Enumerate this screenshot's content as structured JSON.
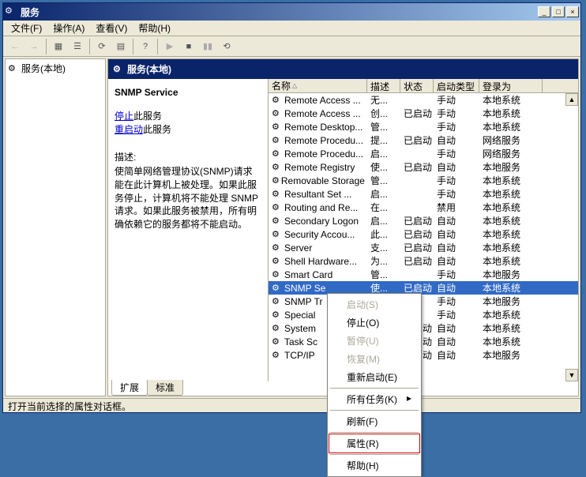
{
  "window": {
    "title": "服务",
    "minimize": "_",
    "maximize": "□",
    "close": "×"
  },
  "menubar": {
    "file": "文件(F)",
    "action": "操作(A)",
    "view": "查看(V)",
    "help": "帮助(H)"
  },
  "tree": {
    "root": "服务(本地)"
  },
  "main_header": "服务(本地)",
  "detail": {
    "service_name": "SNMP Service",
    "stop_link": "停止",
    "stop_suffix": "此服务",
    "restart_link": "重启动",
    "restart_suffix": "此服务",
    "desc_label": "描述:",
    "desc_text": "使简单网络管理协议(SNMP)请求能在此计算机上被处理。如果此服务停止，计算机将不能处理 SNMP 请求。如果此服务被禁用，所有明确依赖它的服务都将不能启动。"
  },
  "columns": {
    "name": "名称",
    "desc": "描述",
    "status": "状态",
    "start": "启动类型",
    "logon": "登录为"
  },
  "services": [
    {
      "name": "Remote Access ...",
      "desc": "无...",
      "status": "",
      "start": "手动",
      "logon": "本地系统"
    },
    {
      "name": "Remote Access ...",
      "desc": "创...",
      "status": "已启动",
      "start": "手动",
      "logon": "本地系统"
    },
    {
      "name": "Remote Desktop...",
      "desc": "管...",
      "status": "",
      "start": "手动",
      "logon": "本地系统"
    },
    {
      "name": "Remote Procedu...",
      "desc": "提...",
      "status": "已启动",
      "start": "自动",
      "logon": "网络服务"
    },
    {
      "name": "Remote Procedu...",
      "desc": "启...",
      "status": "",
      "start": "手动",
      "logon": "网络服务"
    },
    {
      "name": "Remote Registry",
      "desc": "使...",
      "status": "已启动",
      "start": "自动",
      "logon": "本地服务"
    },
    {
      "name": "Removable Storage",
      "desc": "管...",
      "status": "",
      "start": "手动",
      "logon": "本地系统"
    },
    {
      "name": "Resultant Set ...",
      "desc": "启...",
      "status": "",
      "start": "手动",
      "logon": "本地系统"
    },
    {
      "name": "Routing and Re...",
      "desc": "在...",
      "status": "",
      "start": "禁用",
      "logon": "本地系统"
    },
    {
      "name": "Secondary Logon",
      "desc": "启...",
      "status": "已启动",
      "start": "自动",
      "logon": "本地系统"
    },
    {
      "name": "Security Accou...",
      "desc": "此...",
      "status": "已启动",
      "start": "自动",
      "logon": "本地系统"
    },
    {
      "name": "Server",
      "desc": "支...",
      "status": "已启动",
      "start": "自动",
      "logon": "本地系统"
    },
    {
      "name": "Shell Hardware...",
      "desc": "为...",
      "status": "已启动",
      "start": "自动",
      "logon": "本地系统"
    },
    {
      "name": "Smart Card",
      "desc": "管...",
      "status": "",
      "start": "手动",
      "logon": "本地服务"
    },
    {
      "name": "SNMP Se",
      "desc": "使...",
      "status": "已启动",
      "start": "自动",
      "logon": "本地系统",
      "selected": true
    },
    {
      "name": "SNMP Tr",
      "desc": "",
      "status": "",
      "start": "手动",
      "logon": "本地服务"
    },
    {
      "name": "Special",
      "desc": "",
      "status": "",
      "start": "手动",
      "logon": "本地系统"
    },
    {
      "name": "System ",
      "desc": "",
      "status": "已启动",
      "start": "自动",
      "logon": "本地系统"
    },
    {
      "name": "Task Sc",
      "desc": "",
      "status": "已启动",
      "start": "自动",
      "logon": "本地系统"
    },
    {
      "name": "TCP/IP ",
      "desc": "",
      "status": "已启动",
      "start": "自动",
      "logon": "本地服务"
    }
  ],
  "tabs": {
    "extended": "扩展",
    "standard": "标准"
  },
  "statusbar": "打开当前选择的属性对话框。",
  "context_menu": {
    "start": "启动(S)",
    "stop": "停止(O)",
    "pause": "暂停(U)",
    "resume": "恢复(M)",
    "restart": "重新启动(E)",
    "all_tasks": "所有任务(K)",
    "refresh": "刷新(F)",
    "properties": "属性(R)",
    "help": "帮助(H)",
    "arrow": "▸"
  }
}
